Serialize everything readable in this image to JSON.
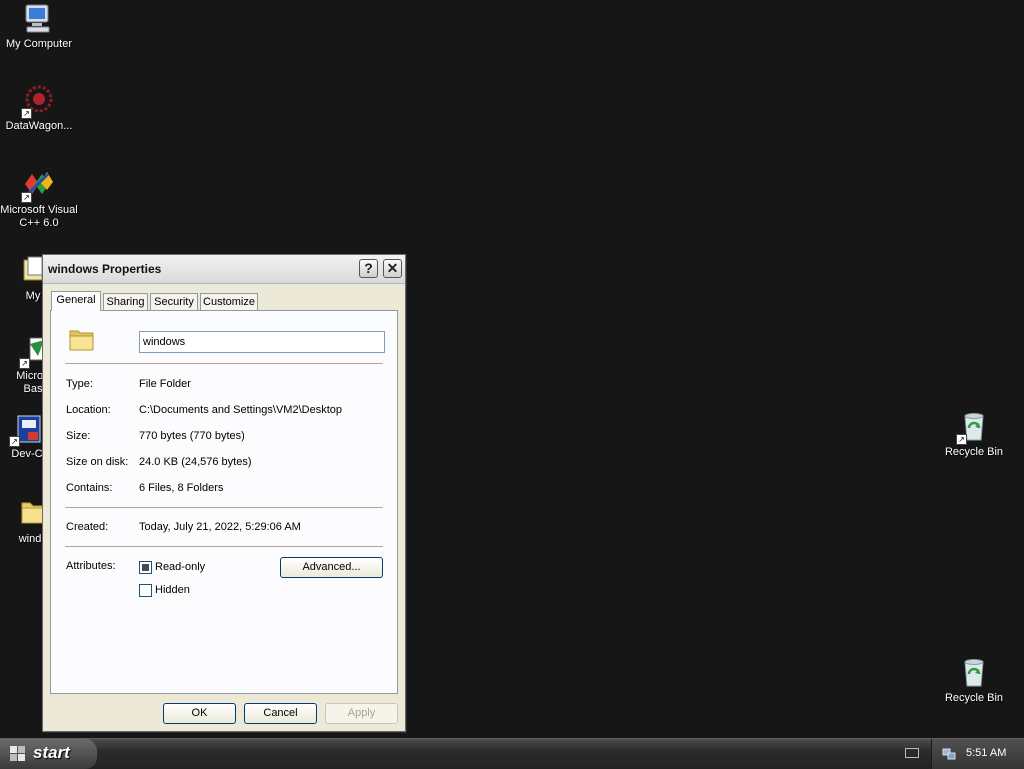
{
  "desktop": {
    "icons": [
      {
        "label": "My Computer",
        "icon": "computer-icon"
      },
      {
        "label": "DataWagon...",
        "icon": "datawagon-icon"
      },
      {
        "label": "Microsoft Visual\nC++ 6.0",
        "icon": "visual-cpp-icon"
      },
      {
        "label": "My",
        "icon": "my-documents-icon"
      },
      {
        "label": "Microsof\nBasic",
        "icon": "visual-basic-icon"
      },
      {
        "label": "Dev-C",
        "icon": "dev-cpp-icon"
      },
      {
        "label": "wind",
        "icon": "folder-icon"
      },
      {
        "label": "Recycle Bin",
        "icon": "recycle-bin-icon"
      },
      {
        "label": "Recycle Bin",
        "icon": "recycle-bin-icon"
      }
    ]
  },
  "dialog": {
    "title": "windows Properties",
    "help_button": "?",
    "close_button": "✕",
    "tabs": [
      "General",
      "Sharing",
      "Security",
      "Customize"
    ],
    "active_tab": "General",
    "name_value": "windows",
    "properties": {
      "type_label": "Type:",
      "type_value": "File Folder",
      "location_label": "Location:",
      "location_value": "C:\\Documents and Settings\\VM2\\Desktop",
      "size_label": "Size:",
      "size_value": "770 bytes (770 bytes)",
      "size_on_disk_label": "Size on disk:",
      "size_on_disk_value": "24.0 KB (24,576 bytes)",
      "contains_label": "Contains:",
      "contains_value": "6 Files, 8 Folders",
      "created_label": "Created:",
      "created_value": "Today, July 21, 2022, 5:29:06 AM",
      "attributes_label": "Attributes:"
    },
    "attributes": {
      "readonly_label": "Read-only",
      "readonly_checked": true,
      "hidden_label": "Hidden",
      "hidden_checked": false
    },
    "advanced_button": "Advanced...",
    "ok_button": "OK",
    "cancel_button": "Cancel",
    "apply_button": "Apply"
  },
  "taskbar": {
    "start_label": "start",
    "clock": "5:51 AM"
  }
}
